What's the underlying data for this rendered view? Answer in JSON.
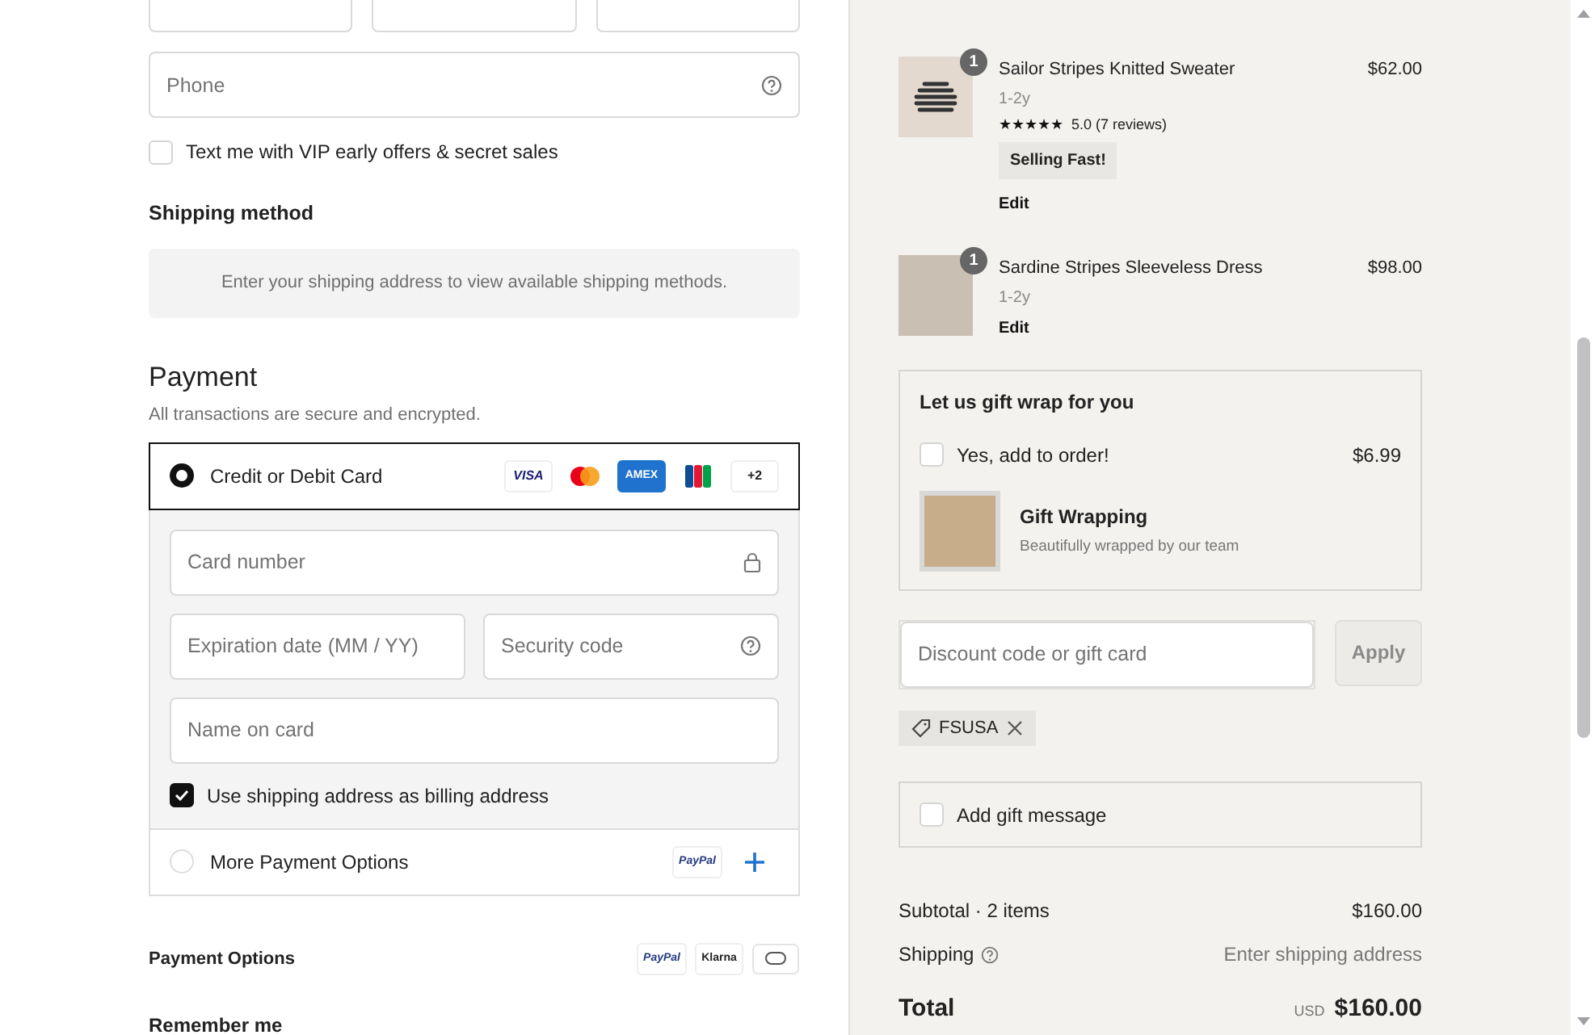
{
  "phone": {
    "placeholder": "Phone"
  },
  "sms_optin": {
    "label": "Text me with VIP early offers & secret sales",
    "checked": false
  },
  "shipping_method": {
    "title": "Shipping method",
    "message": "Enter your shipping address to view available shipping methods."
  },
  "payment": {
    "title": "Payment",
    "subtitle": "All transactions are secure and encrypted.",
    "methods": [
      {
        "label": "Credit or Debit Card",
        "selected": true,
        "badges": [
          {
            "kind": "visa",
            "text": "VISA"
          },
          {
            "kind": "mastercard"
          },
          {
            "kind": "amex",
            "text": "AMEX"
          },
          {
            "kind": "jcb"
          },
          {
            "kind": "more",
            "text": "+2"
          }
        ]
      },
      {
        "label": "More Payment Options",
        "selected": false,
        "badges": [
          {
            "kind": "paypal",
            "text": "PayPal"
          },
          {
            "kind": "plus"
          }
        ]
      }
    ],
    "card_fields": [
      {
        "placeholder": "Card number"
      },
      {
        "placeholder": "Expiration date (MM / YY)"
      },
      {
        "placeholder": "Security code"
      },
      {
        "placeholder": "Name on card"
      }
    ],
    "billing_same": {
      "label": "Use shipping address as billing address",
      "checked": true
    }
  },
  "payment_options": {
    "title": "Payment Options",
    "badges": [
      {
        "kind": "paypal",
        "text": "PayPal"
      },
      {
        "kind": "klarna",
        "text": "Klarna"
      },
      {
        "kind": "card"
      }
    ]
  },
  "remember_me": {
    "title": "Remember me"
  },
  "cart": [
    {
      "name": "Sailor Stripes Knitted Sweater",
      "quantity": "1",
      "variant": "1-2y",
      "price": "$62.00",
      "stars": 5,
      "rating": "5.0 (7 reviews)",
      "tag": "Selling Fast!",
      "edit": "Edit"
    },
    {
      "name": "Sardine Stripes Sleeveless Dress",
      "quantity": "1",
      "variant": "1-2y",
      "price": "$98.00",
      "edit": "Edit"
    }
  ],
  "gift_wrap": {
    "title": "Let us gift wrap for you",
    "option": {
      "label": "Yes, add to order!",
      "price": "$6.99",
      "checked": false
    },
    "product": {
      "name": "Gift Wrapping",
      "description": "Beautifully wrapped by our team"
    }
  },
  "discount": {
    "placeholder": "Discount code or gift card",
    "button": "Apply",
    "applied_code": "FSUSA"
  },
  "gift_message": {
    "label": "Add gift message",
    "checked": false
  },
  "summary": {
    "subtotal_label": "Subtotal · 2 items",
    "subtotal": "$160.00",
    "shipping_label": "Shipping",
    "shipping": "Enter shipping address",
    "total_label": "Total",
    "currency": "USD",
    "total": "$160.00"
  }
}
